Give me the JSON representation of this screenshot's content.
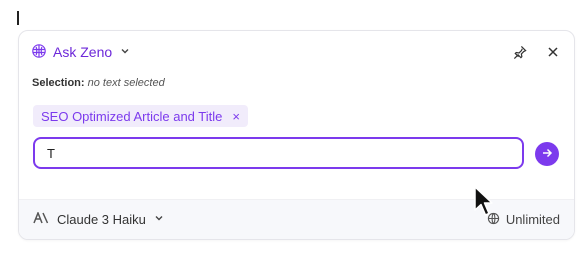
{
  "header": {
    "ask_label": "Ask Zeno"
  },
  "selection": {
    "label": "Selection:",
    "value": "no text selected"
  },
  "chip": {
    "label": "SEO Optimized Article and Title",
    "close": "×"
  },
  "input": {
    "value": "T"
  },
  "footer": {
    "model": "Claude 3 Haiku",
    "usage": "Unlimited"
  },
  "colors": {
    "accent": "#7c3aed",
    "chip_bg": "#f1ecfb",
    "footer_bg": "#f7f8fb"
  },
  "icons": [
    "brain-icon",
    "chevron-down-icon",
    "pin-icon",
    "close-icon",
    "arrow-right-icon",
    "anthropic-icon",
    "globe-icon",
    "mouse-pointer-icon"
  ]
}
